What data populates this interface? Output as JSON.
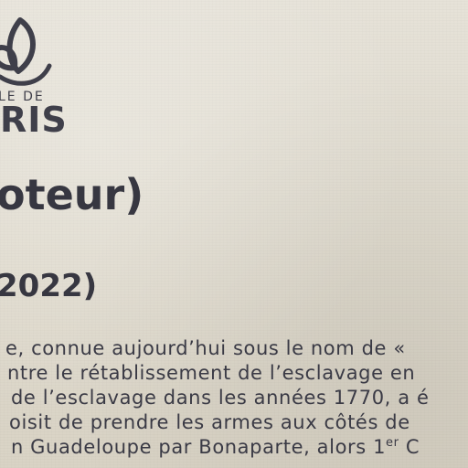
{
  "logo": {
    "icon": "flower-logo-icon",
    "line1": "LE DE",
    "line2": "RIS"
  },
  "title": "oteur)",
  "dates": "2022)",
  "body_lines": [
    "e, connue aujourd’hui sous le nom de «",
    "ntre le rétablissement de l’esclavage en",
    "de l’esclavage dans les années 1770, a é",
    "oisit de prendre les armes aux côtés de",
    "n Guadeloupe par Bonaparte, alors 1"
  ],
  "body_line5_sup": "er",
  "body_line5_tail": " C"
}
